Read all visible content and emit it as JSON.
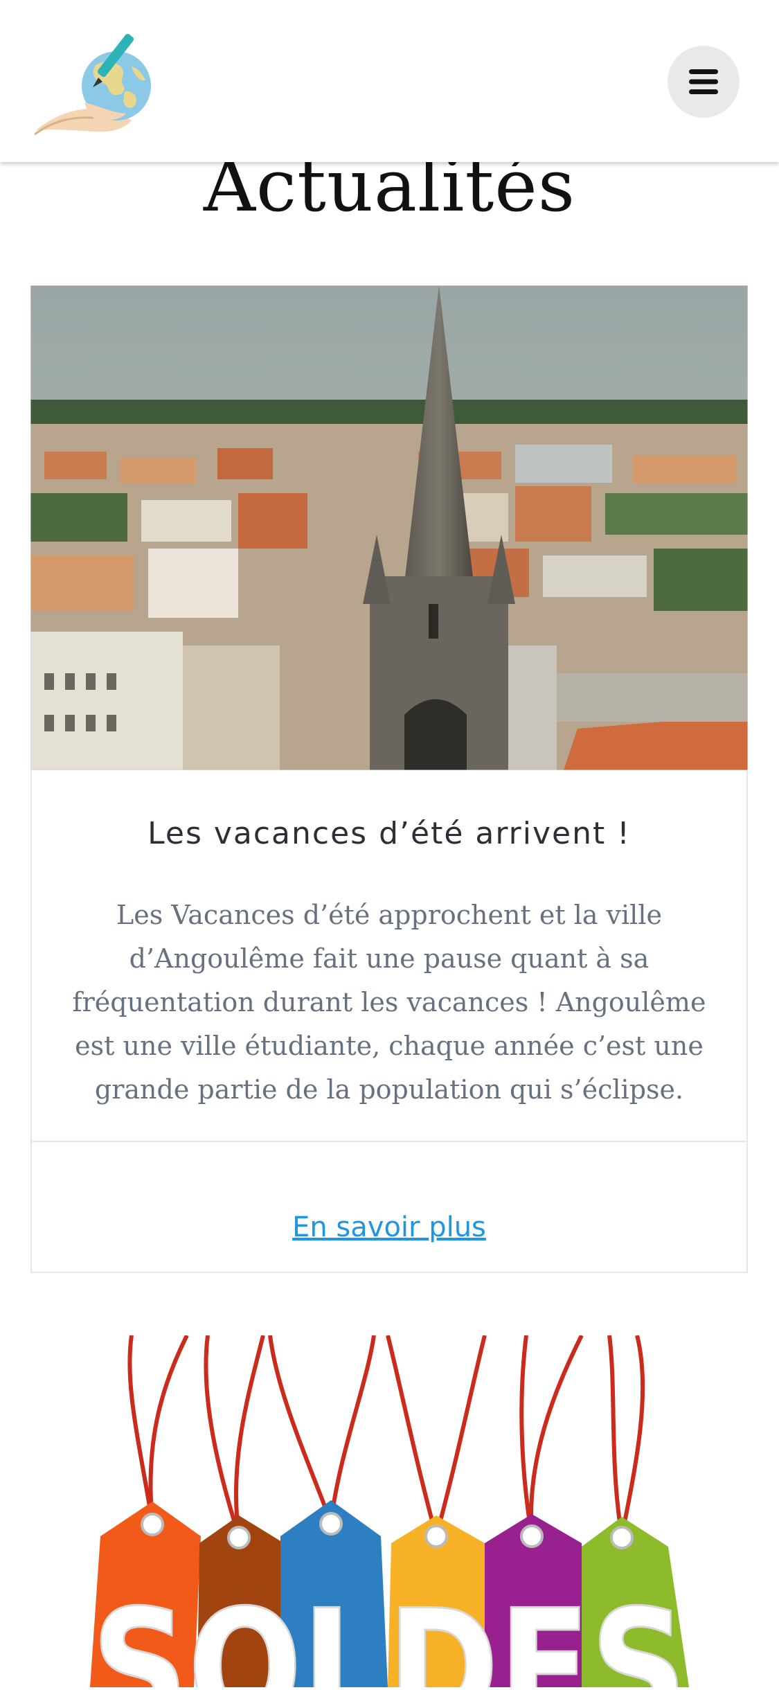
{
  "header": {
    "logo_icon": "globe-in-hand-with-pen-icon",
    "menu_icon": "hamburger-menu-icon"
  },
  "page": {
    "title": "Actualités"
  },
  "articles": [
    {
      "image": "church-spire-city-photo",
      "title": "Les vacances d’été arrivent !",
      "excerpt": "Les Vacances d’été approchent et la ville d’Angoulême fait une pause quant à sa fréquentation durant les vacances ! Angoulême est une ville étudiante, chaque année c’est une grande partie de la population qui s’éclipse.",
      "link_label": "En savoir plus"
    },
    {
      "image": "soldes-price-tags-image",
      "image_text": "SOLDES"
    }
  ],
  "colors": {
    "link": "#1e96e2",
    "text": "#66707f",
    "title": "#2c2f36"
  }
}
